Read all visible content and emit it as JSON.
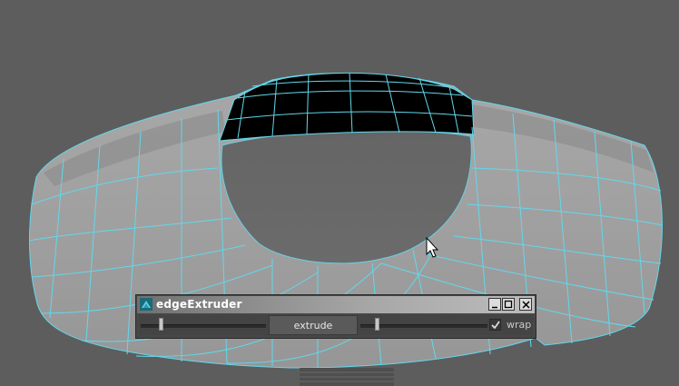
{
  "viewport": {
    "background_color": "#5d5d5d",
    "wireframe_color": "#62d8ec",
    "surface_color": "#9e9e9e",
    "selected_face_color": "#000000",
    "cursor_icon": "arrow-cursor-icon"
  },
  "tool_window": {
    "title": "edgeExtruder",
    "icon": "app-icon",
    "buttons": {
      "minimize_icon": "minimize-icon",
      "maximize_icon": "maximize-icon",
      "close_icon": "close-icon"
    },
    "controls": {
      "extrude_label": "extrude",
      "wrap_label": "wrap",
      "wrap_checked": true,
      "left_slider_value": 0.16,
      "right_slider_value": 0.13
    }
  }
}
